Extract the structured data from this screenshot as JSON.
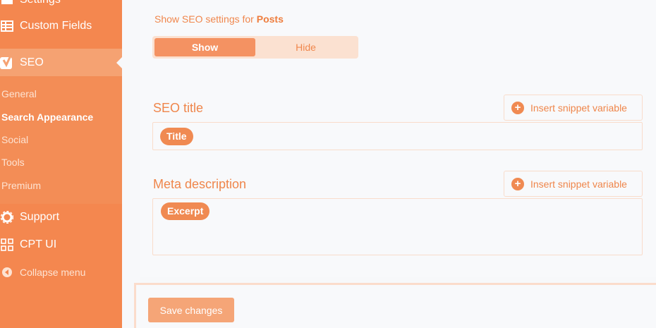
{
  "sidebar": {
    "settings_label": "Settings",
    "custom_fields_label": "Custom Fields",
    "seo_label": "SEO",
    "seo_submenu": [
      "General",
      "Search Appearance",
      "Social",
      "Tools",
      "Premium"
    ],
    "active_submenu": "Search Appearance",
    "support_label": "Support",
    "cptui_label": "CPT UI",
    "collapse_label": "Collapse menu"
  },
  "main": {
    "show_settings_prefix": "Show SEO settings for",
    "show_settings_type": "Posts",
    "toggle": {
      "show_label": "Show",
      "hide_label": "Hide",
      "selected": "Show"
    },
    "seo_title": {
      "label": "SEO title",
      "snippet_button": "Insert snippet variable",
      "tag": "Title"
    },
    "meta_description": {
      "label": "Meta description",
      "snippet_button": "Insert snippet variable",
      "tag": "Excerpt"
    },
    "save_button": "Save changes"
  },
  "colors": {
    "sidebar": "#f4874f",
    "accent": "#f08a52",
    "background": "#f7f8fa"
  }
}
